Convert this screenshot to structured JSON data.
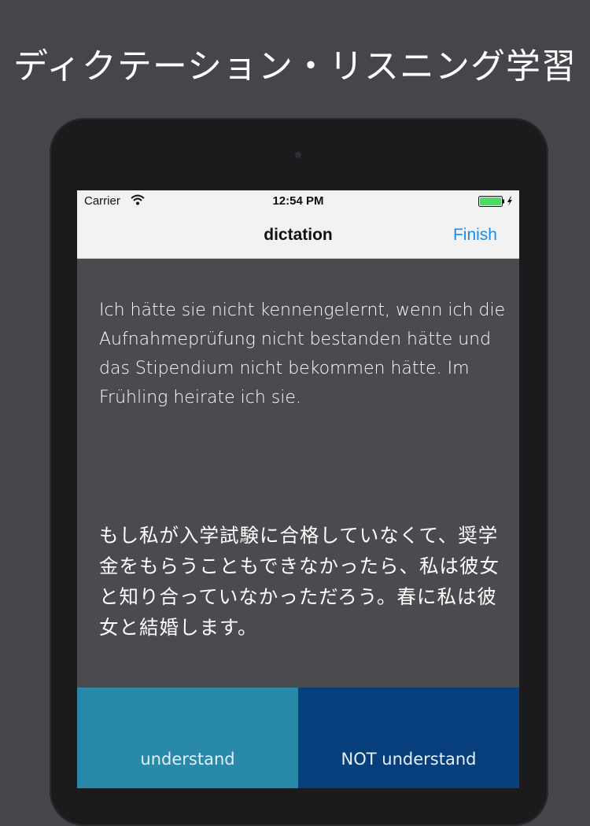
{
  "promo": {
    "title": "ディクテーション・リスニング学習"
  },
  "status_bar": {
    "carrier": "Carrier",
    "time": "12:54 PM",
    "icons": [
      "wifi-icon",
      "battery-icon",
      "charging-icon"
    ],
    "battery_color": "#4cd964"
  },
  "nav": {
    "title": "dictation",
    "finish_label": "Finish",
    "accent_color": "#1a8cf0"
  },
  "content": {
    "german_text": "Ich hätte sie nicht kennengelernt, wenn ich die Aufnahmeprüfung nicht bestanden hätte und das Stipendium nicht bekommen hätte. Im Frühling heirate ich sie.",
    "japanese_text": "もし私が入学試験に合格していなくて、奨学金をもらうこともできなかったら、私は彼女と知り合っていなかっただろう。春に私は彼女と結婚します。"
  },
  "buttons": {
    "understand_label": "understand",
    "not_understand_label": "NOT understand",
    "understand_color": "#2889a9",
    "not_understand_color": "#073f7c"
  }
}
